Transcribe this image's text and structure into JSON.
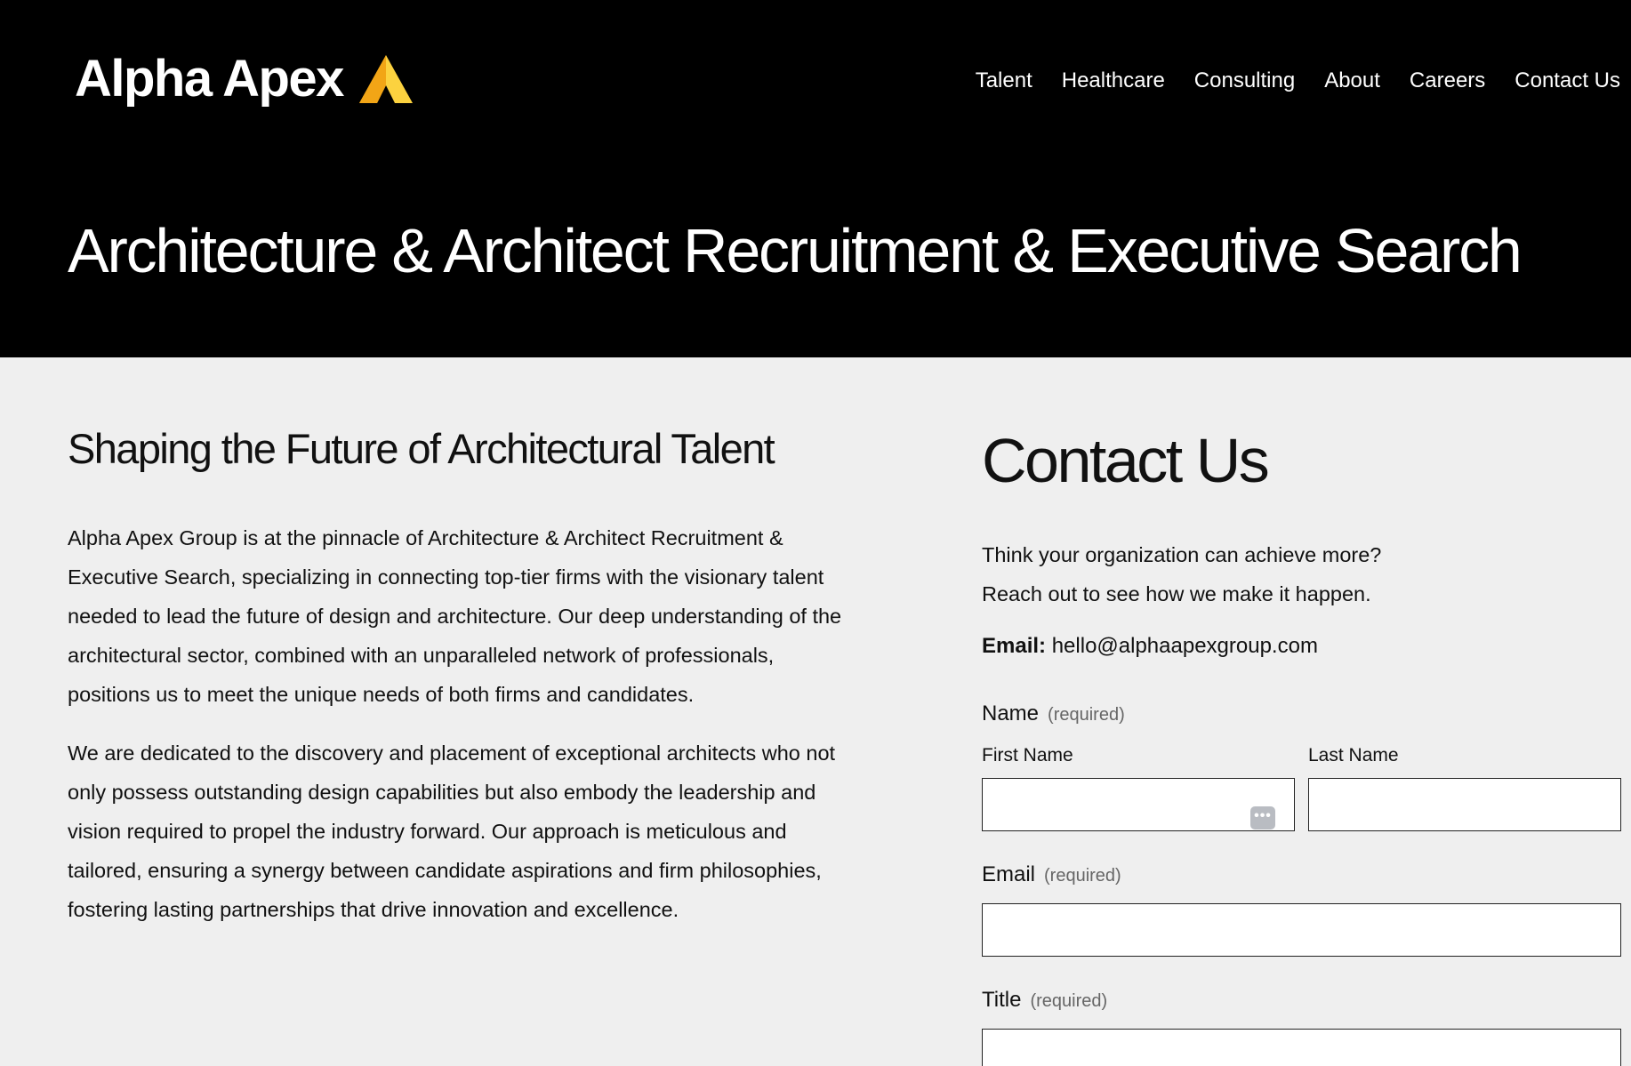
{
  "header": {
    "brand": "Alpha Apex",
    "logo_mark_color": "#f5b21c",
    "nav": [
      "Talent",
      "Healthcare",
      "Consulting",
      "About",
      "Careers",
      "Contact Us"
    ]
  },
  "hero": {
    "title": "Architecture & Architect Recruitment & Executive Search"
  },
  "about": {
    "heading": "Shaping the Future of Architectural Talent",
    "paragraphs": [
      "Alpha Apex Group is at the pinnacle of Architecture & Architect Recruitment & Executive Search, specializing in connecting top-tier firms with the visionary talent needed to lead the future of design and architecture. Our deep understanding of the architectural sector, combined with an unparalleled network of professionals, positions us to meet the unique needs of both firms and candidates.",
      "We are dedicated to the discovery and placement of exceptional architects who not only possess outstanding design capabilities but also embody the leadership and vision required to propel the industry forward. Our approach is meticulous and tailored, ensuring a synergy between candidate aspirations and firm philosophies, fostering lasting partnerships that drive innovation and excellence."
    ]
  },
  "contact": {
    "heading": "Contact Us",
    "intro_line1": "Think your organization can achieve more?",
    "intro_line2": "Reach out to see how we make it happen.",
    "email_label": "Email:",
    "email_value": "hello@alphaapexgroup.com",
    "form": {
      "name_label": "Name",
      "required_text": "(required)",
      "first_name_label": "First Name",
      "first_name_value": "",
      "last_name_label": "Last Name",
      "last_name_value": "",
      "email_label": "Email",
      "email_value": "",
      "title_label": "Title",
      "title_value": "",
      "password_manager_icon": "•••"
    }
  }
}
